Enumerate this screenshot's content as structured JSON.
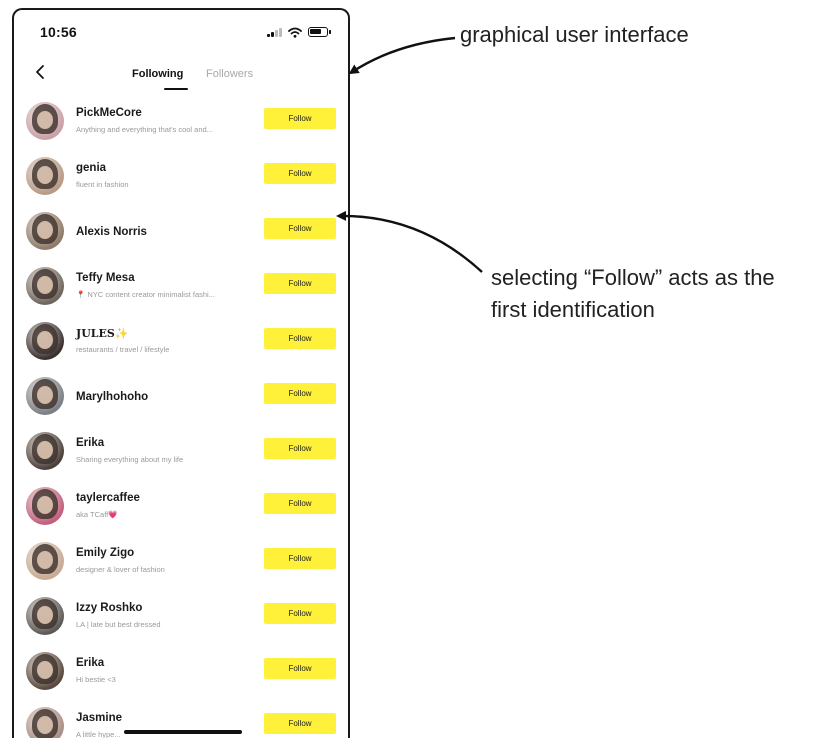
{
  "status_bar": {
    "time": "10:56",
    "icons": [
      "signal-icon",
      "wifi-icon",
      "battery-icon"
    ]
  },
  "nav": {
    "back_icon": "chevron-left-icon",
    "tabs": [
      {
        "label": "Following",
        "active": true
      },
      {
        "label": "Followers",
        "active": false
      }
    ]
  },
  "users": [
    {
      "name": "PickMeCore",
      "bio": "Anything and everything that's cool and...",
      "button": "Follow",
      "avatar_color": "#c9a1a8"
    },
    {
      "name": "genia",
      "bio": "fluent in fashion",
      "button": "Follow",
      "avatar_color": "#b89a86"
    },
    {
      "name": "Alexis Norris",
      "bio": "",
      "button": "Follow",
      "avatar_color": "#8e7b6a"
    },
    {
      "name": "Teffy Mesa",
      "bio": "📍 NYC content creator minimalist fashi...",
      "button": "Follow",
      "avatar_color": "#6f6660"
    },
    {
      "name": "JULES✨",
      "bio": "restaurants / travel / lifestyle",
      "button": "Follow",
      "avatar_color": "#3a3030"
    },
    {
      "name": "Marylhohoho",
      "bio": "",
      "button": "Follow",
      "avatar_color": "#7b7f86"
    },
    {
      "name": "Erika",
      "bio": "Sharing everything about my life",
      "button": "Follow",
      "avatar_color": "#4a403c"
    },
    {
      "name": "taylercaffee",
      "bio": "aka TCaff💗",
      "button": "Follow",
      "avatar_color": "#c2607e"
    },
    {
      "name": "Emily Zigo",
      "bio": "designer & lover of fashion",
      "button": "Follow",
      "avatar_color": "#c7ab95"
    },
    {
      "name": "Izzy Roshko",
      "bio": "LA | late but best dressed",
      "button": "Follow",
      "avatar_color": "#5c5a58"
    },
    {
      "name": "Erika",
      "bio": "Hi bestie <3",
      "button": "Follow",
      "avatar_color": "#5a4a40"
    },
    {
      "name": "Jasmine",
      "bio": "A little hype...",
      "button": "Follow",
      "avatar_color": "#a98f86"
    }
  ],
  "annotations": {
    "gui_label": "graphical user interface",
    "follow_label_line1": "selecting “Follow” acts as the",
    "follow_label_line2": "first identification"
  },
  "colors": {
    "follow_button": "#fff13a",
    "inactive_tab": "#a8a8a8",
    "bio_text": "#9a9a9a"
  }
}
